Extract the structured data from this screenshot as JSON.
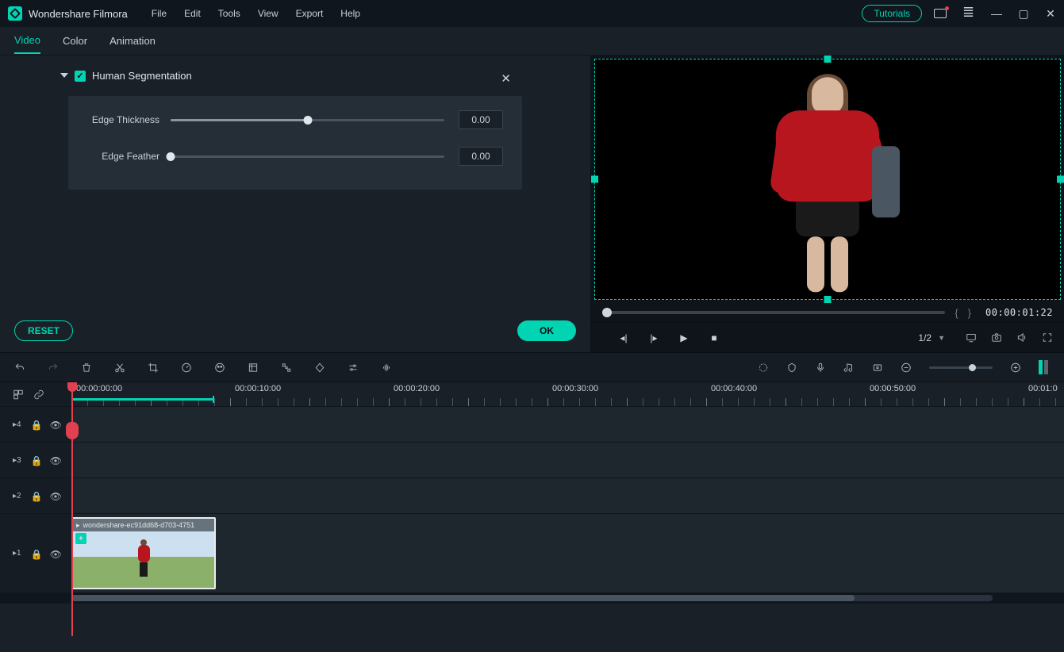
{
  "app": {
    "name": "Wondershare Filmora"
  },
  "menu": {
    "file": "File",
    "edit": "Edit",
    "tools": "Tools",
    "view": "View",
    "export": "Export",
    "help": "Help"
  },
  "titlebar": {
    "tutorials": "Tutorials"
  },
  "tabs": {
    "video": "Video",
    "color": "Color",
    "animation": "Animation"
  },
  "section": {
    "title": "Human Segmentation",
    "edge_thickness": {
      "label": "Edge Thickness",
      "value": "0.00",
      "pct": 50
    },
    "edge_feather": {
      "label": "Edge Feather",
      "value": "0.00",
      "pct": 0
    }
  },
  "actions": {
    "reset": "RESET",
    "ok": "OK"
  },
  "preview": {
    "timestamp": "00:00:01:22",
    "ratio": "1/2"
  },
  "ruler": [
    "00:00:00:00",
    "00:00:10:00",
    "00:00:20:00",
    "00:00:30:00",
    "00:00:40:00",
    "00:00:50:00",
    "00:01:0"
  ],
  "tracks": [
    "4",
    "3",
    "2",
    "1"
  ],
  "clip": {
    "name": "wondershare-ec91dd68-d703-4751"
  }
}
